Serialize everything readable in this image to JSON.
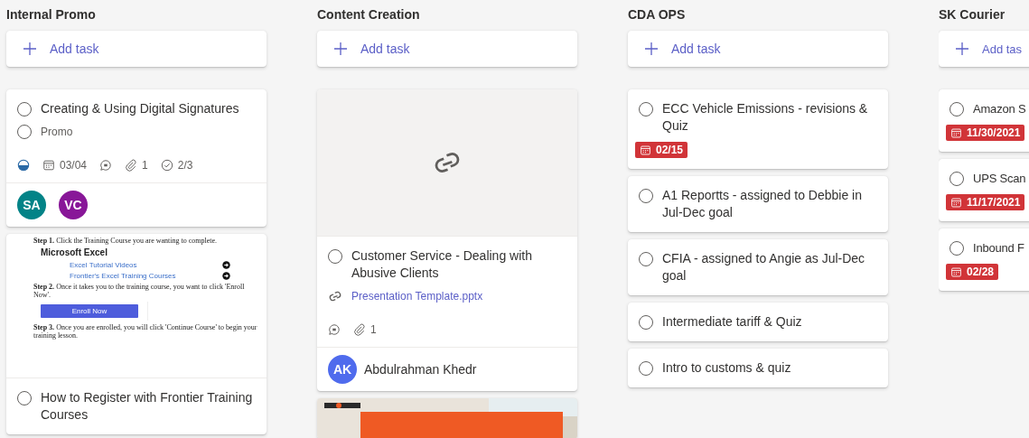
{
  "columns": [
    {
      "title": "Internal Promo",
      "add_label": "Add task",
      "tasks": [
        {
          "title": "Creating & Using Digital Signatures",
          "completed": false,
          "checklist": [
            {
              "text": "Promo",
              "checked": false
            }
          ],
          "in_progress": true,
          "due": {
            "date": "03/04",
            "overdue": false
          },
          "has_comments": true,
          "attachments_count": "1",
          "checklist_count": "2/3",
          "assignees": [
            {
              "initials": "SA",
              "color": "#038387"
            },
            {
              "initials": "VC",
              "color": "#881798"
            }
          ]
        },
        {
          "title": "How to Register with Frontier Training Courses",
          "completed": false,
          "preview": {
            "kind": "document",
            "lines": [
              {
                "kind": "step",
                "text": "**Step 1.** Click the Training Course you are wanting to complete."
              },
              {
                "kind": "heading",
                "text": "Microsoft Excel"
              },
              {
                "kind": "link_row",
                "text": "Excel Tutorial Videos"
              },
              {
                "kind": "link_row",
                "text": "Frontier's Excel Training Courses"
              },
              {
                "kind": "step",
                "text": "**Step 2.** Once it takes you to the training course, you want to click 'Enroll Now'."
              },
              {
                "kind": "button",
                "text": "Enroll Now"
              },
              {
                "kind": "step",
                "text": "**Step 3.** Once you are enrolled, you will click 'Continue Course' to begin your training lesson."
              }
            ]
          }
        }
      ]
    },
    {
      "title": "Content Creation",
      "add_label": "Add task",
      "tasks": [
        {
          "title": "Customer Service - Dealing with Abusive Clients",
          "completed": false,
          "preview": {
            "kind": "link"
          },
          "attachment": "Presentation Template.pptx",
          "has_comments": true,
          "attachments_count": "1",
          "assignees": [
            {
              "initials": "AK",
              "name": "Abdulrahman Khedr",
              "color": "#4f6bed"
            }
          ]
        },
        {
          "preview": {
            "kind": "picture"
          }
        }
      ]
    },
    {
      "title": "CDA OPS",
      "add_label": "Add task",
      "tasks": [
        {
          "title": "ECC Vehicle Emissions - revisions & Quiz",
          "completed": false,
          "due": {
            "date": "02/15",
            "overdue": true
          }
        },
        {
          "title": "A1 Reportts - assigned to Debbie in Jul-Dec goal",
          "completed": false
        },
        {
          "title": "CFIA - assigned to Angie as Jul-Dec goal",
          "completed": false
        },
        {
          "title": "Intermediate tariff & Quiz",
          "completed": false
        },
        {
          "title": "Intro to customs & quiz",
          "completed": false
        }
      ]
    },
    {
      "title": "SK Courier",
      "add_label": "Add tas",
      "tasks": [
        {
          "title": "Amazon S",
          "completed": false,
          "due": {
            "date": "11/30/2021",
            "overdue": true
          }
        },
        {
          "title": "UPS Scan",
          "completed": false,
          "due": {
            "date": "11/17/2021",
            "overdue": true
          }
        },
        {
          "title": "Inbound F",
          "completed": false,
          "due": {
            "date": "02/28",
            "overdue": true
          }
        }
      ]
    }
  ]
}
